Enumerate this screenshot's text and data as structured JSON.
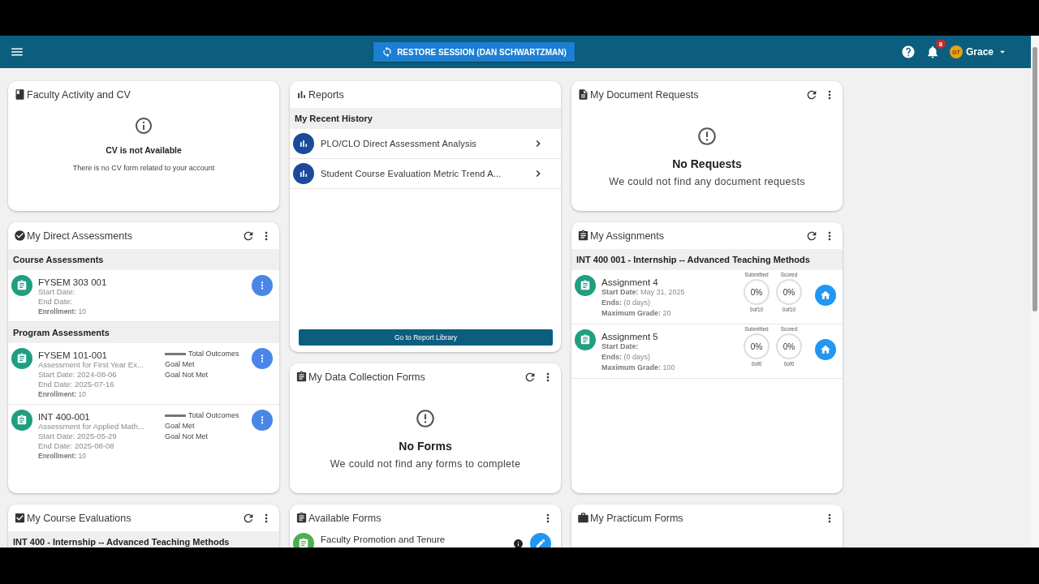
{
  "topbar": {
    "restore_button": "RESTORE SESSION (DAN SCHWARTZMAN)",
    "notification_count": "8",
    "user_initials": "GT",
    "user_name": "Grace"
  },
  "columns": [
    {
      "cards": [
        {
          "kind": "notice_small",
          "title": "Faculty Activity and CV",
          "refresh": false,
          "menu": false,
          "heading": "CV is not Available",
          "message": "There is no CV form related to your account"
        },
        {
          "kind": "assessments",
          "title": "My Direct Assessments",
          "refresh": true,
          "menu": true,
          "sections": [
            {
              "title": "Course Assessments",
              "items": [
                {
                  "name": "FYSEM 303 001",
                  "lines": [
                    "Start Date:",
                    "End Date:"
                  ],
                  "enrollment_label": "Enrollment:",
                  "enrollment": "10"
                }
              ]
            },
            {
              "title": "Program Assessments",
              "items": [
                {
                  "name": "FYSEM 101-001",
                  "lines": [
                    "Assessment for First Year Ex...",
                    "Start Date: 2024-08-06",
                    "End Date: 2025-07-16"
                  ],
                  "enrollment_label": "Enrollment:",
                  "enrollment": "10",
                  "legend": [
                    "Total Outcomes",
                    "Goal Met",
                    "Goal Not Met"
                  ]
                },
                {
                  "name": "INT 400-001",
                  "lines": [
                    "Assessment for Applied Math...",
                    "Start Date: 2025-05-29",
                    "End Date: 2025-08-08"
                  ],
                  "enrollment_label": "Enrollment:",
                  "enrollment": "10",
                  "legend": [
                    "Total Outcomes",
                    "Goal Met",
                    "Goal Not Met"
                  ]
                }
              ]
            }
          ]
        },
        {
          "kind": "evaluations",
          "title": "My Course Evaluations",
          "refresh": true,
          "menu": true,
          "group": "INT 400 - Internship -- Advanced Teaching Methods"
        }
      ]
    },
    {
      "cards": [
        {
          "kind": "reports",
          "title": "Reports",
          "refresh": false,
          "menu": false,
          "section": "My Recent History",
          "items": [
            "PLO/CLO Direct Assessment Analysis",
            "Student Course Evaluation Metric Trend A..."
          ],
          "button": "Go to Report Library"
        },
        {
          "kind": "notice",
          "title": "My Data Collection Forms",
          "refresh": true,
          "menu": true,
          "heading": "No Forms",
          "message": "We could not find any forms to complete"
        },
        {
          "kind": "forms",
          "title": "Available Forms",
          "refresh": false,
          "menu": true,
          "items": [
            "Faculty Promotion and Tenure"
          ]
        }
      ]
    },
    {
      "cards": [
        {
          "kind": "notice",
          "title": "My Document Requests",
          "refresh": true,
          "menu": true,
          "heading": "No Requests",
          "message": "We could not find any document requests"
        },
        {
          "kind": "assignments",
          "title": "My Assignments",
          "refresh": true,
          "menu": true,
          "group": "INT 400 001 - Internship -- Advanced Teaching Methods",
          "items": [
            {
              "name": "Assignment 4",
              "fields": [
                {
                  "label": "Start Date:",
                  "value": "May 31, 2025"
                },
                {
                  "label": "Ends:",
                  "value": "(0 days)"
                },
                {
                  "label": "Maximum Grade:",
                  "value": "20"
                }
              ],
              "stats": [
                {
                  "label": "Submitted",
                  "value": "0%",
                  "count": "0of10"
                },
                {
                  "label": "Scored",
                  "value": "0%",
                  "count": "0of10"
                }
              ]
            },
            {
              "name": "Assignment 5",
              "fields": [
                {
                  "label": "Start Date:"
                },
                {
                  "label": "Ends:",
                  "value": "(0 days)"
                },
                {
                  "label": "Maximum Grade:",
                  "value": "100"
                }
              ],
              "stats": [
                {
                  "label": "Submitted",
                  "value": "0%",
                  "count": "0of0"
                },
                {
                  "label": "Scored",
                  "value": "0%",
                  "count": "0of0"
                }
              ]
            }
          ]
        },
        {
          "kind": "blank",
          "title": "My Practicum Forms",
          "refresh": false,
          "menu": true
        }
      ]
    }
  ]
}
